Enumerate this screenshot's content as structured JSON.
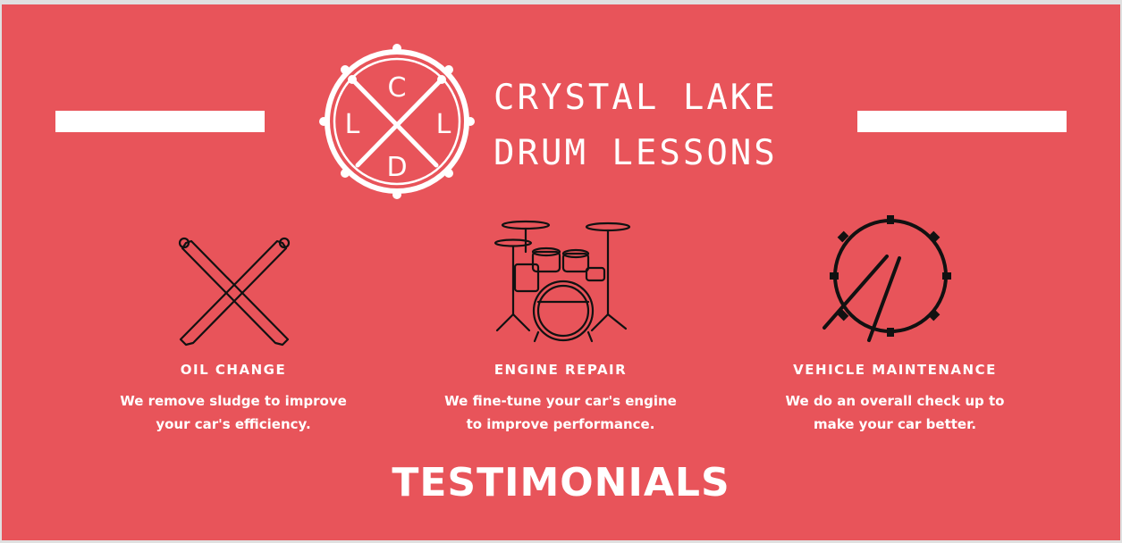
{
  "colors": {
    "background": "#e8545a",
    "foreground": "#ffffff",
    "icon_stroke": "#111111"
  },
  "logo": {
    "emblem_letters": {
      "top": "C",
      "left": "L",
      "right": "L",
      "bottom": "D"
    },
    "line1": "CRYSTAL LAKE",
    "line2": "DRUM LESSONS"
  },
  "services": [
    {
      "icon": "drumsticks-icon",
      "title": "OIL CHANGE",
      "desc_line1": "We remove sludge to improve",
      "desc_line2": "your car's efficiency."
    },
    {
      "icon": "drum-kit-icon",
      "title": "ENGINE REPAIR",
      "desc_line1": "We fine-tune your car's engine",
      "desc_line2": "to improve performance."
    },
    {
      "icon": "snare-drum-icon",
      "title": "VEHICLE MAINTENANCE",
      "desc_line1": "We do an overall check up to",
      "desc_line2": "make your car better."
    }
  ],
  "testimonials": {
    "title": "TESTIMONIALS"
  }
}
